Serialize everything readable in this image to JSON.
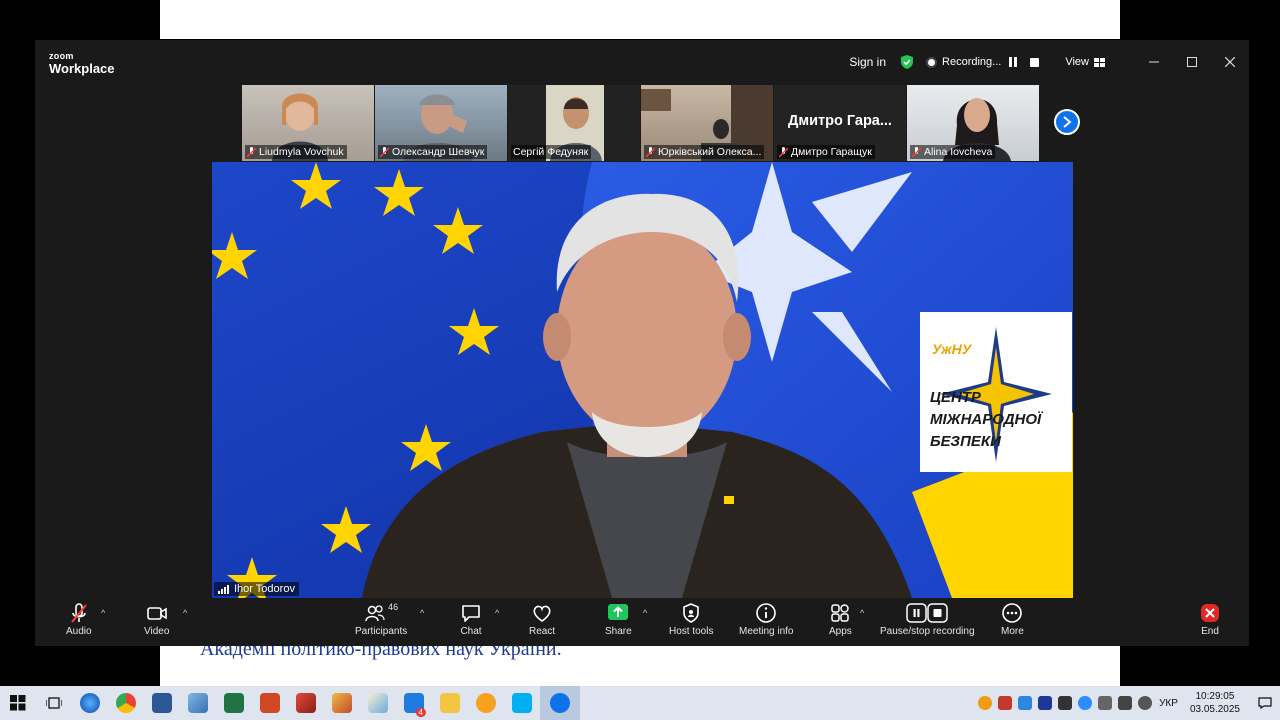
{
  "document": {
    "visible_line": "Академії політико-правових наук України."
  },
  "app": {
    "brand_small": "zoom",
    "brand_name": "Workplace"
  },
  "titlebar": {
    "sign_in": "Sign in",
    "recording_label": "Recording...",
    "view_label": "View"
  },
  "thumbnails": [
    {
      "name": "Liudmyla Vovchuk",
      "muted": true
    },
    {
      "name": "Олександр Шевчук",
      "muted": true
    },
    {
      "name": "Сергій Федуняк",
      "muted": false
    },
    {
      "name": "Юрківський Олекса...",
      "muted": true
    },
    {
      "name": "Дмитро Гаращук",
      "muted": true,
      "display_text": "Дмитро Гара..."
    },
    {
      "name": "Alina Iovcheva",
      "muted": true
    }
  ],
  "main_video": {
    "speaker": "Ihor Todorov",
    "logo_lines": [
      "УжНУ",
      "ЦЕНТР",
      "МІЖНАРОДНОЇ",
      "БЕЗПЕКИ"
    ]
  },
  "toolbar": {
    "audio": "Audio",
    "video": "Video",
    "participants": "Participants",
    "participants_count": "46",
    "chat": "Chat",
    "react": "React",
    "share": "Share",
    "host_tools": "Host tools",
    "meeting_info": "Meeting info",
    "apps": "Apps",
    "pause_stop": "Pause/stop recording",
    "more": "More",
    "end": "End"
  },
  "taskbar": {
    "language": "УКР",
    "time": "10:29:05",
    "date": "03.05.2025",
    "mail_badge": "4"
  },
  "colors": {
    "zoom_blue": "#0e72ed",
    "share_green": "#21c55d",
    "end_red": "#e02828"
  }
}
